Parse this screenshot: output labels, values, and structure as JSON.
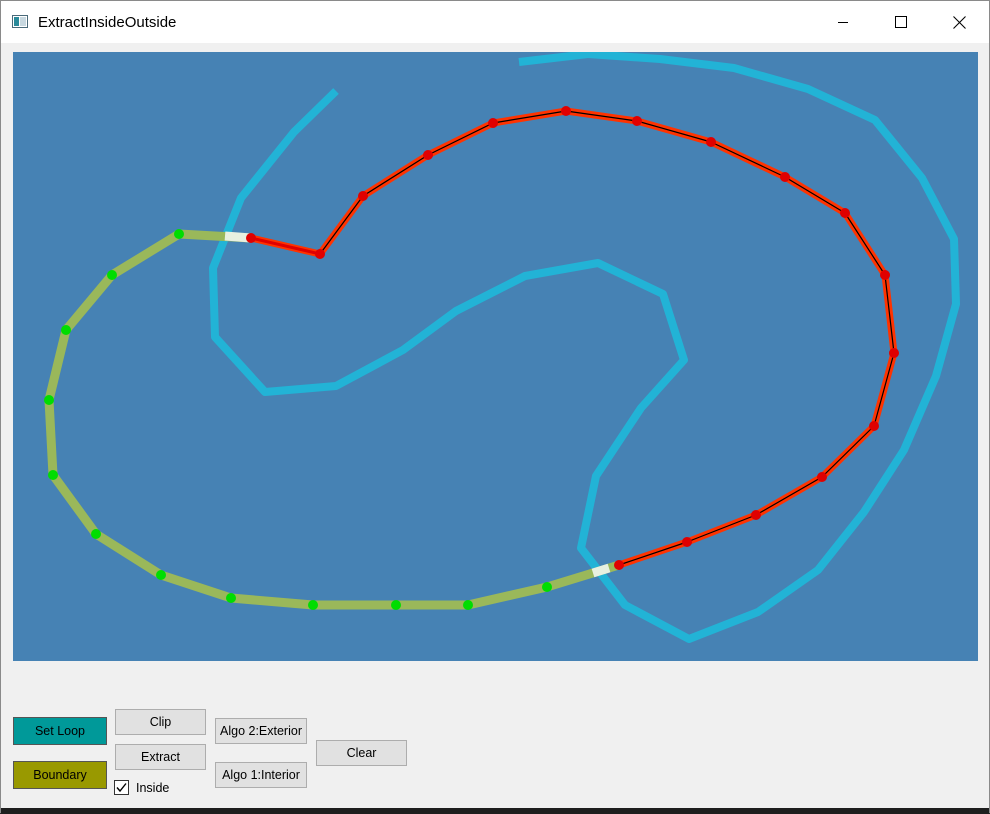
{
  "window": {
    "title": "ExtractInsideOutside",
    "icon": "app-window-icon",
    "controls": [
      "minimize-icon",
      "maximize-icon",
      "close-icon"
    ]
  },
  "canvas": {
    "background": "#4682b4",
    "boundary_color": "#22b3d6",
    "inside_color": "#ff3300",
    "outside_color": "#9ab85a",
    "inside_point_color": "#e00000",
    "outside_point_color": "#00dd00"
  },
  "toolbar": {
    "set_loop_label": "Set Loop",
    "boundary_label": "Boundary",
    "clip_label": "Clip",
    "extract_label": "Extract",
    "algo2_label": "Algo 2:Exterior",
    "algo1_label": "Algo 1:Interior",
    "clear_label": "Clear",
    "inside_label": "Inside",
    "inside_checked": true
  },
  "colors": {
    "set_loop_bg": "#009999",
    "boundary_bg": "#999900"
  }
}
